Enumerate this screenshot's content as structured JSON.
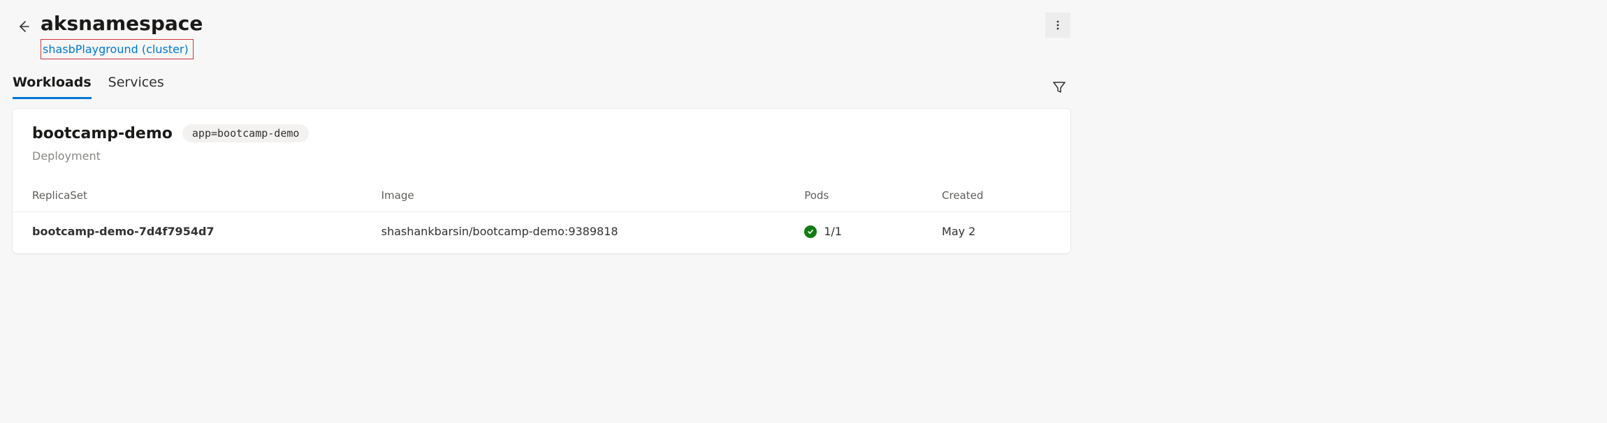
{
  "header": {
    "title": "aksnamespace",
    "breadcrumb": "shasbPlayground (cluster)"
  },
  "tabs": {
    "items": [
      {
        "label": "Workloads",
        "active": true
      },
      {
        "label": "Services",
        "active": false
      }
    ]
  },
  "workload": {
    "name": "bootcamp-demo",
    "tag": "app=bootcamp-demo",
    "kind": "Deployment"
  },
  "table": {
    "columns": {
      "replicaset": "ReplicaSet",
      "image": "Image",
      "pods": "Pods",
      "created": "Created"
    },
    "rows": [
      {
        "replicaset": "bootcamp-demo-7d4f7954d7",
        "image": "shashankbarsin/bootcamp-demo:9389818",
        "pods": "1/1",
        "pods_status": "ok",
        "created": "May 2"
      }
    ]
  },
  "colors": {
    "accent": "#0078d4",
    "ok": "#107c10",
    "highlight_border": "#d13438"
  }
}
